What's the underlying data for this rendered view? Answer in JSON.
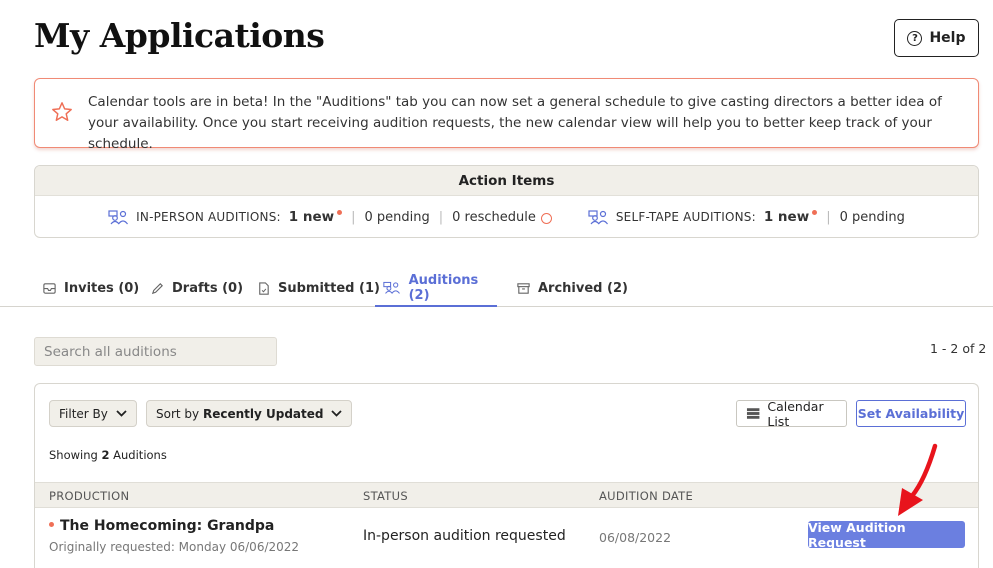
{
  "header": {
    "title": "My Applications",
    "help_label": "Help"
  },
  "banner": {
    "text": "Calendar tools are in beta! In the \"Auditions\" tab you can now set a general schedule to give casting directors a better idea of your availability. Once you start receiving audition requests, the new calendar view will help you to better keep track of your schedule.",
    "icon": "star-icon",
    "accent_color": "#f08a75"
  },
  "action_items": {
    "title": "Action Items",
    "in_person": {
      "label": "IN-PERSON AUDITIONS:",
      "new": "1 new",
      "pending": "0 pending",
      "reschedule": "0 reschedule"
    },
    "self_tape": {
      "label": "SELF-TAPE AUDITIONS:",
      "new": "1 new",
      "pending": "0 pending"
    }
  },
  "tabs": [
    {
      "label": "Invites (0)",
      "icon": "invite-icon"
    },
    {
      "label": "Drafts (0)",
      "icon": "pencil-icon"
    },
    {
      "label": "Submitted (1)",
      "icon": "document-icon"
    },
    {
      "label": "Auditions (2)",
      "icon": "people-icon",
      "active": true
    },
    {
      "label": "Archived (2)",
      "icon": "archive-icon"
    }
  ],
  "search": {
    "placeholder": "Search all auditions",
    "value": ""
  },
  "result_count": "1 - 2 of 2",
  "toolbar": {
    "filter_label": "Filter By",
    "sort_prefix": "Sort by",
    "sort_value": "Recently Updated",
    "calendar_list_label": "Calendar List",
    "set_availability_label": "Set Availability"
  },
  "showing": {
    "prefix": "Showing",
    "count": "2",
    "suffix": "Auditions"
  },
  "table": {
    "columns": [
      "PRODUCTION",
      "STATUS",
      "AUDITION DATE"
    ],
    "rows": [
      {
        "production": "The Homecoming: Grandpa",
        "subtitle": "Originally requested: Monday 06/06/2022",
        "status": "In-person audition requested",
        "audition_date": "06/08/2022",
        "action_label": "View Audition Request"
      }
    ]
  },
  "colors": {
    "accent": "#5b6fd6",
    "button_fill": "#6b7fe0",
    "alert": "#ef6f56",
    "annotation_arrow": "#e8141c"
  }
}
